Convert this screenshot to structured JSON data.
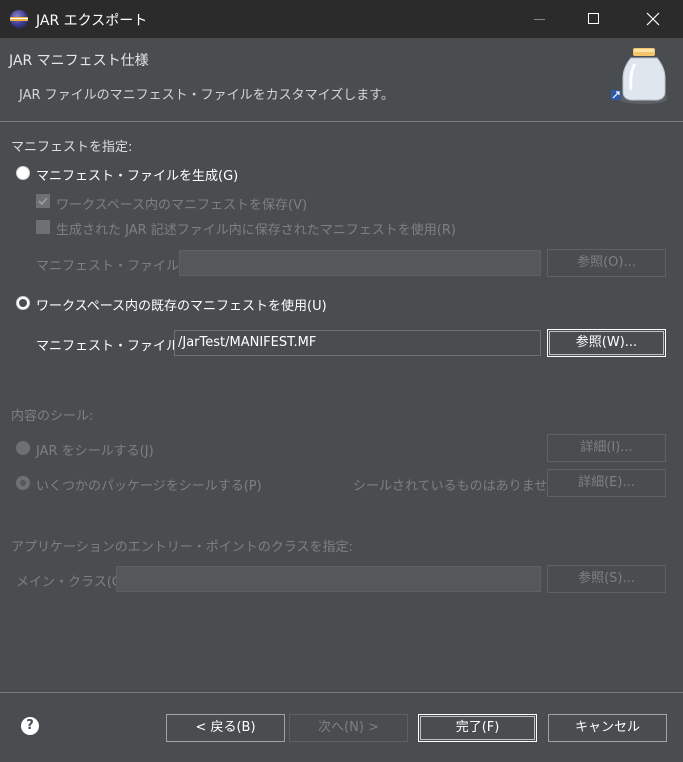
{
  "window": {
    "title": "JAR エクスポート"
  },
  "header": {
    "title": "JAR マニフェスト仕様",
    "description": "JAR ファイルのマニフェスト・ファイルをカスタマイズします。"
  },
  "manifest": {
    "section_label": "マニフェストを指定:",
    "generate_radio": "マニフェスト・ファイルを生成(G)",
    "save_in_workspace": "ワークスペース内のマニフェストを保存(V)",
    "reuse_saved": "生成された JAR 記述ファイル内に保存されたマニフェストを使用(R)",
    "manifest_file_m_label": "マニフェスト・ファイル(M):",
    "manifest_file_m_value": "",
    "browse_o": "参照(O)...",
    "use_existing_radio": "ワークスペース内の既存のマニフェストを使用(U)",
    "manifest_file_a_label": "マニフェスト・ファイル(A):",
    "manifest_file_a_value": "/JarTest/MANIFEST.MF",
    "browse_w": "参照(W)..."
  },
  "seal": {
    "section_label": "内容のシール:",
    "seal_jar": "JAR をシールする(J)",
    "details_i": "詳細(I)...",
    "seal_some": "いくつかのパッケージをシールする(P)",
    "sealed_status": "シールされているものはありません",
    "details_e": "詳細(E)..."
  },
  "entry": {
    "section_label": "アプリケーションのエントリー・ポイントのクラスを指定:",
    "main_class_label": "メイン・クラス(C):",
    "main_class_value": "",
    "browse_s": "参照(S)..."
  },
  "footer": {
    "help": "?",
    "back": "< 戻る(B)",
    "next": "次へ(N) >",
    "finish": "完了(F)",
    "cancel": "キャンセル"
  }
}
